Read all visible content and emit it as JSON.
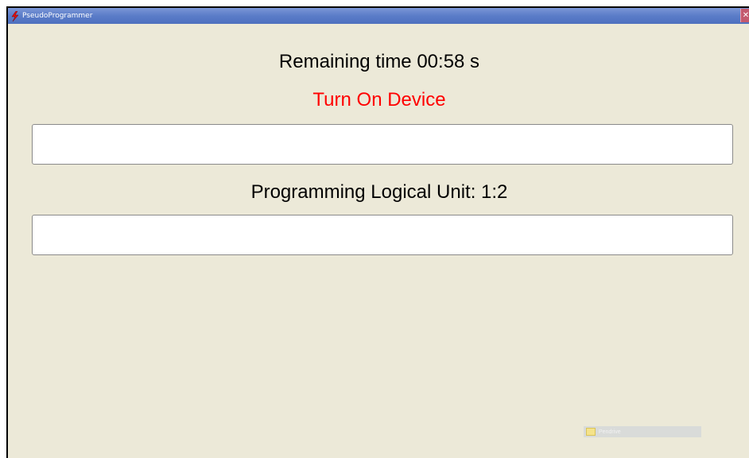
{
  "window": {
    "title": "PseudoProgrammer",
    "close_glyph": "✕"
  },
  "main": {
    "remaining_time": "Remaining time 00:58 s",
    "status_message": "Turn On Device",
    "status_color": "#ff0000",
    "unit_label": "Programming Logical Unit: 1:2",
    "field_one_value": "",
    "field_two_value": ""
  },
  "tray": {
    "icon": "folder-icon",
    "label": "Pendrive"
  },
  "icons": {
    "app": "lightning-bolt-icon",
    "close": "close-icon"
  }
}
